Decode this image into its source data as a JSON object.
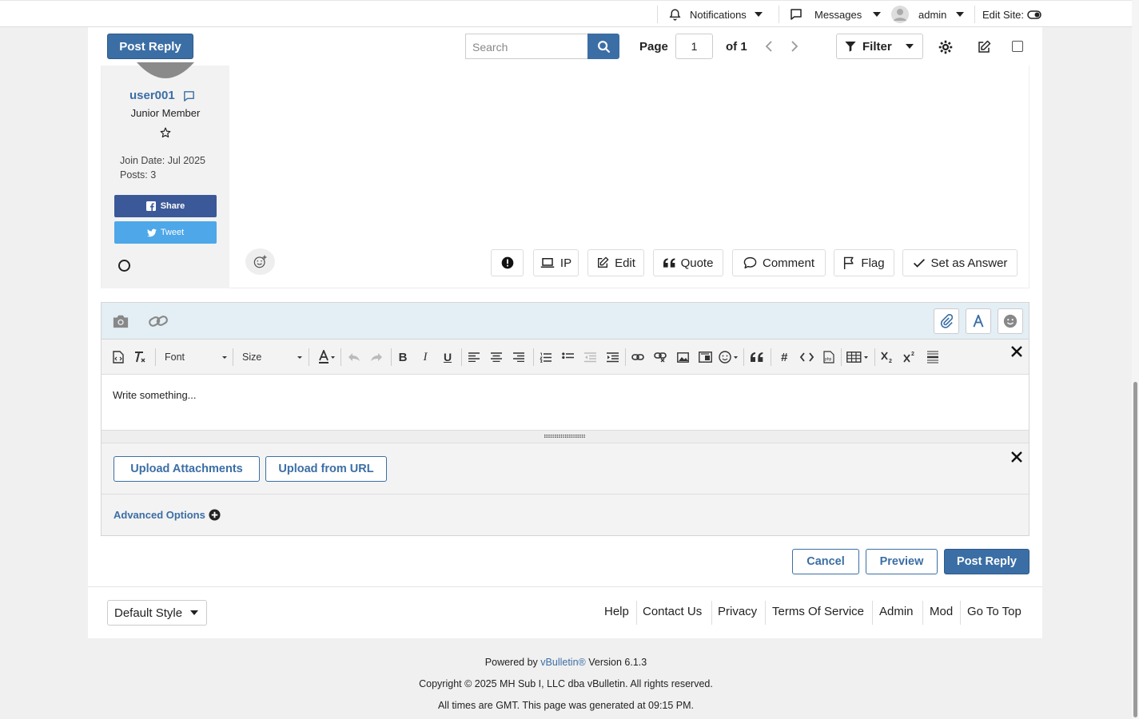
{
  "topnav": {
    "notifications": "Notifications",
    "messages": "Messages",
    "user": "admin",
    "edit_site": "Edit Site:"
  },
  "toolbar": {
    "post_reply": "Post Reply",
    "search_placeholder": "Search",
    "page_label": "Page",
    "page_value": "1",
    "page_of": "of 1",
    "filter": "Filter"
  },
  "post": {
    "username": "user001",
    "user_title": "Junior Member",
    "join_date": "Join Date: Jul 2025",
    "posts": "Posts: 3",
    "share": "Share",
    "tweet": "Tweet",
    "actions": {
      "ip": "IP",
      "edit": "Edit",
      "quote": "Quote",
      "comment": "Comment",
      "flag": "Flag",
      "set_answer": "Set as Answer"
    }
  },
  "editor": {
    "font_select": "Font",
    "size_select": "Size",
    "placeholder": "Write something...",
    "upload_attachments": "Upload Attachments",
    "upload_from_url": "Upload from URL",
    "advanced_options": "Advanced Options"
  },
  "form_buttons": {
    "cancel": "Cancel",
    "preview": "Preview",
    "post_reply": "Post Reply"
  },
  "footer": {
    "style": "Default Style",
    "links": [
      "Help",
      "Contact Us",
      "Privacy",
      "Terms Of Service",
      "Admin",
      "Mod",
      "Go To Top"
    ],
    "powered_by": "Powered by",
    "brand": "vBulletin®",
    "version": "Version 6.1.3",
    "copyright": "Copyright © 2025 MH Sub I, LLC dba vBulletin. All rights reserved.",
    "times": "All times are GMT. This page was generated at 09:15 PM."
  },
  "colors": {
    "accent": "#3b6ea5",
    "facebook": "#3b5998",
    "twitter": "#4da7e8"
  }
}
